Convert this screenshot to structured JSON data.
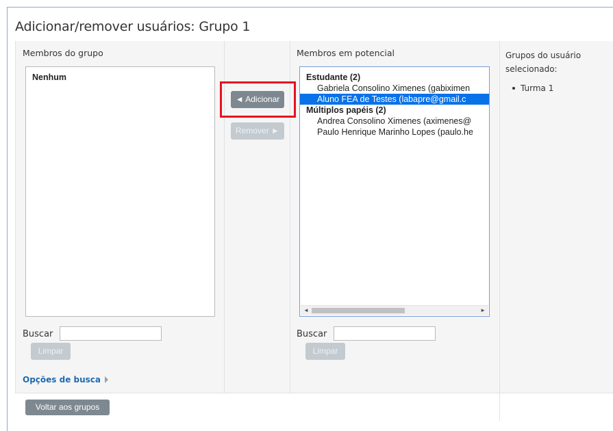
{
  "page_title": "Adicionar/remover usuários: Grupo 1",
  "members": {
    "label": "Membros do grupo",
    "list": [
      {
        "type": "group",
        "label": "Nenhum"
      }
    ],
    "search_label": "Buscar",
    "search_value": "",
    "clear_label": "Limpar",
    "search_options_label": "Opções de busca"
  },
  "actions": {
    "add_label": "◄ Adicionar",
    "remove_label": "Remover ►"
  },
  "potential": {
    "label": "Membros em potencial",
    "groups": [
      {
        "label": "Estudante (2)",
        "options": [
          {
            "label": "Gabriela Consolino Ximenes (gabiximen",
            "selected": false
          },
          {
            "label": "Aluno FEA de Testes (labapre@gmail.c",
            "selected": true
          }
        ]
      },
      {
        "label": "Múltiplos papéis (2)",
        "options": [
          {
            "label": "Andrea Consolino Ximenes (aximenes@",
            "selected": false
          },
          {
            "label": "Paulo Henrique Marinho Lopes (paulo.he",
            "selected": false
          }
        ]
      }
    ],
    "search_label": "Buscar",
    "search_value": "",
    "clear_label": "Limpar"
  },
  "user_groups": {
    "label_line1": "Grupos do usuário",
    "label_line2": "selecionado:",
    "items": [
      "Turma 1"
    ]
  },
  "footer": {
    "back_label": "Voltar aos grupos"
  },
  "colors": {
    "selected_row": "#0a72e8",
    "highlight": "#e8101f",
    "button_active": "#7e8890",
    "button_disabled": "#c3cbd1",
    "link": "#1f6bb0"
  }
}
